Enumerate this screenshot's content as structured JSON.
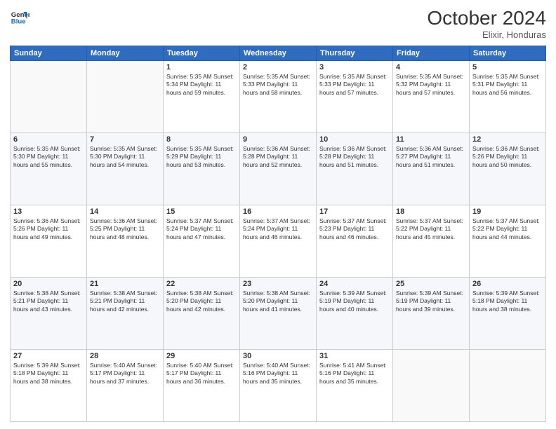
{
  "header": {
    "logo_line1": "General",
    "logo_line2": "Blue",
    "month": "October 2024",
    "location": "Elixir, Honduras"
  },
  "weekdays": [
    "Sunday",
    "Monday",
    "Tuesday",
    "Wednesday",
    "Thursday",
    "Friday",
    "Saturday"
  ],
  "weeks": [
    [
      {
        "day": "",
        "info": ""
      },
      {
        "day": "",
        "info": ""
      },
      {
        "day": "1",
        "info": "Sunrise: 5:35 AM\nSunset: 5:34 PM\nDaylight: 11 hours and 59 minutes."
      },
      {
        "day": "2",
        "info": "Sunrise: 5:35 AM\nSunset: 5:33 PM\nDaylight: 11 hours and 58 minutes."
      },
      {
        "day": "3",
        "info": "Sunrise: 5:35 AM\nSunset: 5:33 PM\nDaylight: 11 hours and 57 minutes."
      },
      {
        "day": "4",
        "info": "Sunrise: 5:35 AM\nSunset: 5:32 PM\nDaylight: 11 hours and 57 minutes."
      },
      {
        "day": "5",
        "info": "Sunrise: 5:35 AM\nSunset: 5:31 PM\nDaylight: 11 hours and 56 minutes."
      }
    ],
    [
      {
        "day": "6",
        "info": "Sunrise: 5:35 AM\nSunset: 5:30 PM\nDaylight: 11 hours and 55 minutes."
      },
      {
        "day": "7",
        "info": "Sunrise: 5:35 AM\nSunset: 5:30 PM\nDaylight: 11 hours and 54 minutes."
      },
      {
        "day": "8",
        "info": "Sunrise: 5:35 AM\nSunset: 5:29 PM\nDaylight: 11 hours and 53 minutes."
      },
      {
        "day": "9",
        "info": "Sunrise: 5:36 AM\nSunset: 5:28 PM\nDaylight: 11 hours and 52 minutes."
      },
      {
        "day": "10",
        "info": "Sunrise: 5:36 AM\nSunset: 5:28 PM\nDaylight: 11 hours and 51 minutes."
      },
      {
        "day": "11",
        "info": "Sunrise: 5:36 AM\nSunset: 5:27 PM\nDaylight: 11 hours and 51 minutes."
      },
      {
        "day": "12",
        "info": "Sunrise: 5:36 AM\nSunset: 5:26 PM\nDaylight: 11 hours and 50 minutes."
      }
    ],
    [
      {
        "day": "13",
        "info": "Sunrise: 5:36 AM\nSunset: 5:26 PM\nDaylight: 11 hours and 49 minutes."
      },
      {
        "day": "14",
        "info": "Sunrise: 5:36 AM\nSunset: 5:25 PM\nDaylight: 11 hours and 48 minutes."
      },
      {
        "day": "15",
        "info": "Sunrise: 5:37 AM\nSunset: 5:24 PM\nDaylight: 11 hours and 47 minutes."
      },
      {
        "day": "16",
        "info": "Sunrise: 5:37 AM\nSunset: 5:24 PM\nDaylight: 11 hours and 46 minutes."
      },
      {
        "day": "17",
        "info": "Sunrise: 5:37 AM\nSunset: 5:23 PM\nDaylight: 11 hours and 46 minutes."
      },
      {
        "day": "18",
        "info": "Sunrise: 5:37 AM\nSunset: 5:22 PM\nDaylight: 11 hours and 45 minutes."
      },
      {
        "day": "19",
        "info": "Sunrise: 5:37 AM\nSunset: 5:22 PM\nDaylight: 11 hours and 44 minutes."
      }
    ],
    [
      {
        "day": "20",
        "info": "Sunrise: 5:38 AM\nSunset: 5:21 PM\nDaylight: 11 hours and 43 minutes."
      },
      {
        "day": "21",
        "info": "Sunrise: 5:38 AM\nSunset: 5:21 PM\nDaylight: 11 hours and 42 minutes."
      },
      {
        "day": "22",
        "info": "Sunrise: 5:38 AM\nSunset: 5:20 PM\nDaylight: 11 hours and 42 minutes."
      },
      {
        "day": "23",
        "info": "Sunrise: 5:38 AM\nSunset: 5:20 PM\nDaylight: 11 hours and 41 minutes."
      },
      {
        "day": "24",
        "info": "Sunrise: 5:39 AM\nSunset: 5:19 PM\nDaylight: 11 hours and 40 minutes."
      },
      {
        "day": "25",
        "info": "Sunrise: 5:39 AM\nSunset: 5:19 PM\nDaylight: 11 hours and 39 minutes."
      },
      {
        "day": "26",
        "info": "Sunrise: 5:39 AM\nSunset: 5:18 PM\nDaylight: 11 hours and 38 minutes."
      }
    ],
    [
      {
        "day": "27",
        "info": "Sunrise: 5:39 AM\nSunset: 5:18 PM\nDaylight: 11 hours and 38 minutes."
      },
      {
        "day": "28",
        "info": "Sunrise: 5:40 AM\nSunset: 5:17 PM\nDaylight: 11 hours and 37 minutes."
      },
      {
        "day": "29",
        "info": "Sunrise: 5:40 AM\nSunset: 5:17 PM\nDaylight: 11 hours and 36 minutes."
      },
      {
        "day": "30",
        "info": "Sunrise: 5:40 AM\nSunset: 5:16 PM\nDaylight: 11 hours and 35 minutes."
      },
      {
        "day": "31",
        "info": "Sunrise: 5:41 AM\nSunset: 5:16 PM\nDaylight: 11 hours and 35 minutes."
      },
      {
        "day": "",
        "info": ""
      },
      {
        "day": "",
        "info": ""
      }
    ]
  ]
}
